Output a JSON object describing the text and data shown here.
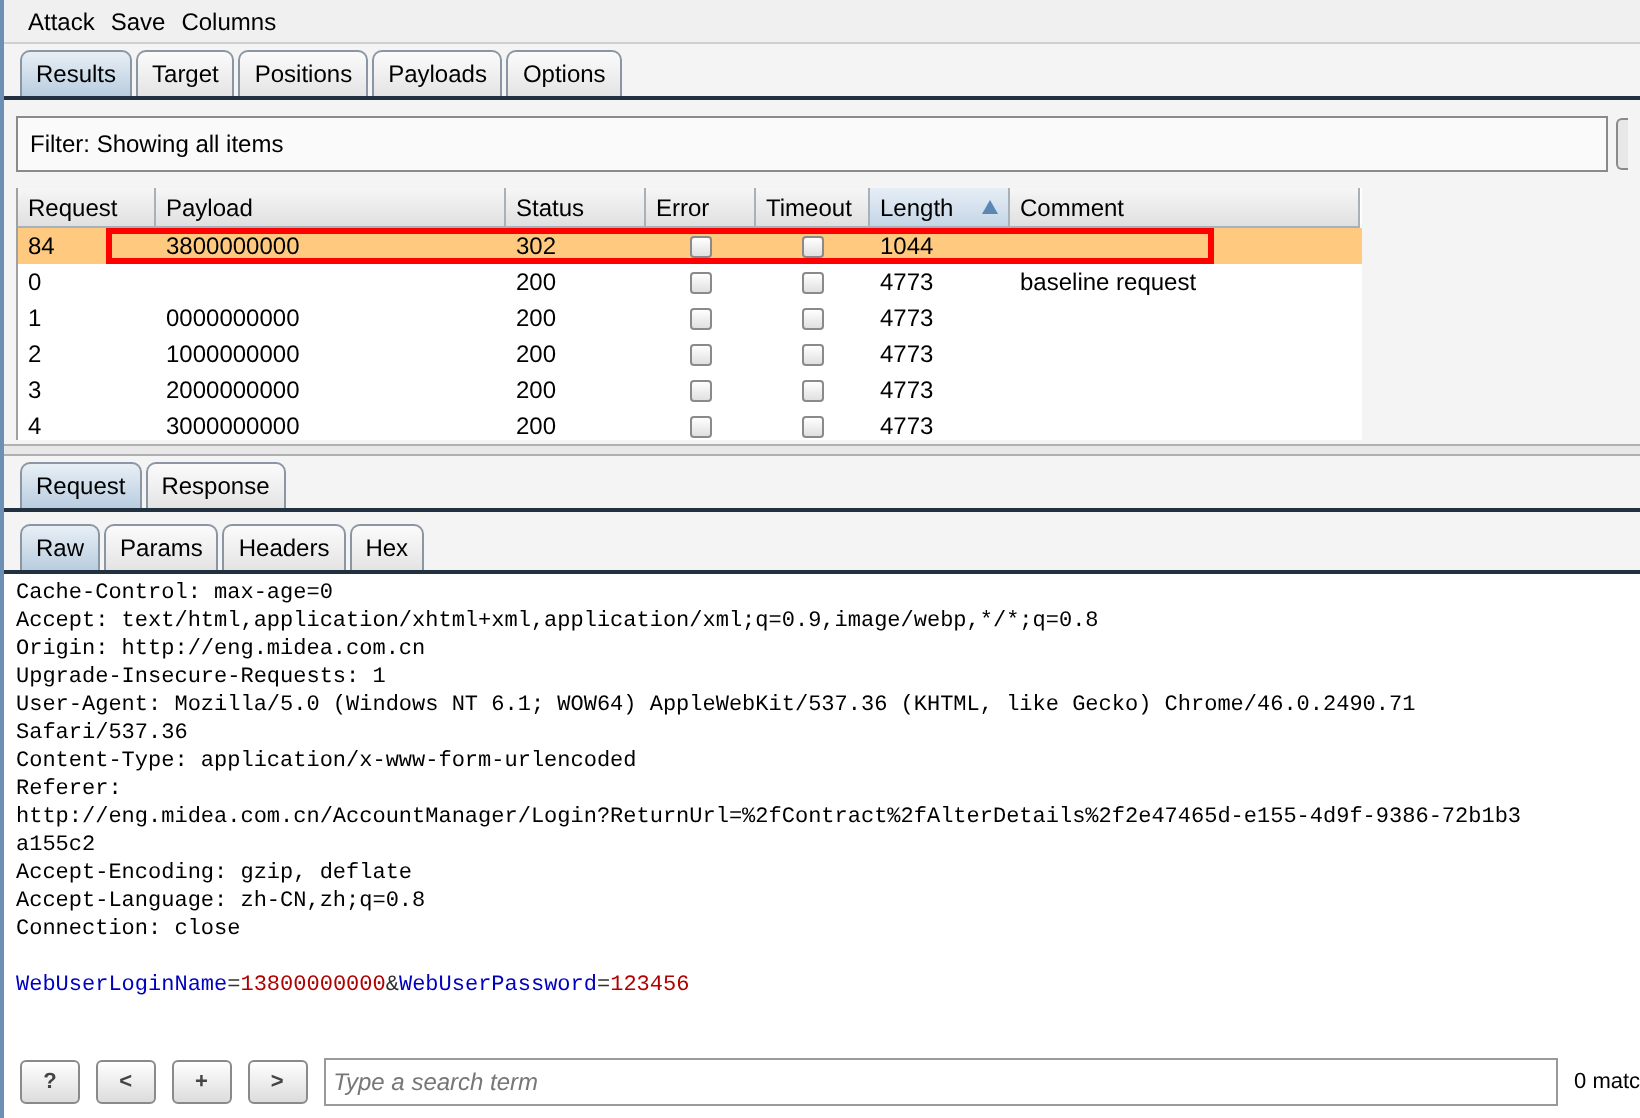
{
  "menu": [
    "Attack",
    "Save",
    "Columns"
  ],
  "tabs": [
    {
      "label": "Results",
      "selected": true
    },
    {
      "label": "Target",
      "selected": false
    },
    {
      "label": "Positions",
      "selected": false
    },
    {
      "label": "Payloads",
      "selected": false
    },
    {
      "label": "Options",
      "selected": false
    }
  ],
  "filter": "Filter:  Showing all items",
  "table": {
    "columns": [
      {
        "label": "Request",
        "sorted": false
      },
      {
        "label": "Payload",
        "sorted": false
      },
      {
        "label": "Status",
        "sorted": false
      },
      {
        "label": "Error",
        "sorted": false
      },
      {
        "label": "Timeout",
        "sorted": false
      },
      {
        "label": "Length",
        "sorted": true
      },
      {
        "label": "Comment",
        "sorted": false
      }
    ],
    "rows": [
      {
        "request": "84",
        "payload": "3800000000",
        "status": "302",
        "error": false,
        "timeout": false,
        "length": "1044",
        "comment": "",
        "selected": true,
        "outlined": true
      },
      {
        "request": "0",
        "payload": "",
        "status": "200",
        "error": false,
        "timeout": false,
        "length": "4773",
        "comment": "baseline request",
        "selected": false,
        "outlined": false
      },
      {
        "request": "1",
        "payload": "0000000000",
        "status": "200",
        "error": false,
        "timeout": false,
        "length": "4773",
        "comment": "",
        "selected": false,
        "outlined": false
      },
      {
        "request": "2",
        "payload": "1000000000",
        "status": "200",
        "error": false,
        "timeout": false,
        "length": "4773",
        "comment": "",
        "selected": false,
        "outlined": false
      },
      {
        "request": "3",
        "payload": "2000000000",
        "status": "200",
        "error": false,
        "timeout": false,
        "length": "4773",
        "comment": "",
        "selected": false,
        "outlined": false
      },
      {
        "request": "4",
        "payload": "3000000000",
        "status": "200",
        "error": false,
        "timeout": false,
        "length": "4773",
        "comment": "",
        "selected": false,
        "outlined": false
      }
    ]
  },
  "message_tabs": [
    {
      "label": "Request",
      "selected": true
    },
    {
      "label": "Response",
      "selected": false
    }
  ],
  "view_tabs": [
    {
      "label": "Raw",
      "selected": true
    },
    {
      "label": "Params",
      "selected": false
    },
    {
      "label": "Headers",
      "selected": false
    },
    {
      "label": "Hex",
      "selected": false
    }
  ],
  "raw_lines": [
    "Cache-Control: max-age=0",
    "Accept: text/html,application/xhtml+xml,application/xml;q=0.9,image/webp,*/*;q=0.8",
    "Origin: http://eng.midea.com.cn",
    "Upgrade-Insecure-Requests: 1",
    "User-Agent: Mozilla/5.0 (Windows NT 6.1; WOW64) AppleWebKit/537.36 (KHTML, like Gecko) Chrome/46.0.2490.71",
    "Safari/537.36",
    "Content-Type: application/x-www-form-urlencoded",
    "Referer:",
    "http://eng.midea.com.cn/AccountManager/Login?ReturnUrl=%2fContract%2fAlterDetails%2f2e47465d-e155-4d9f-9386-72b1b3",
    "a155c2",
    "Accept-Encoding: gzip, deflate",
    "Accept-Language: zh-CN,zh;q=0.8",
    "Connection: close"
  ],
  "body": [
    {
      "kind": "name",
      "text": "WebUserLoginName"
    },
    {
      "kind": "sep",
      "text": "="
    },
    {
      "kind": "value",
      "text": "13800000000"
    },
    {
      "kind": "sep",
      "text": "&"
    },
    {
      "kind": "name",
      "text": "WebUserPassword"
    },
    {
      "kind": "sep",
      "text": "="
    },
    {
      "kind": "value",
      "text": "123456"
    }
  ],
  "search": {
    "buttons": [
      "?",
      "<",
      "+",
      ">"
    ],
    "placeholder": "Type a search term",
    "matches": "0 matc"
  }
}
